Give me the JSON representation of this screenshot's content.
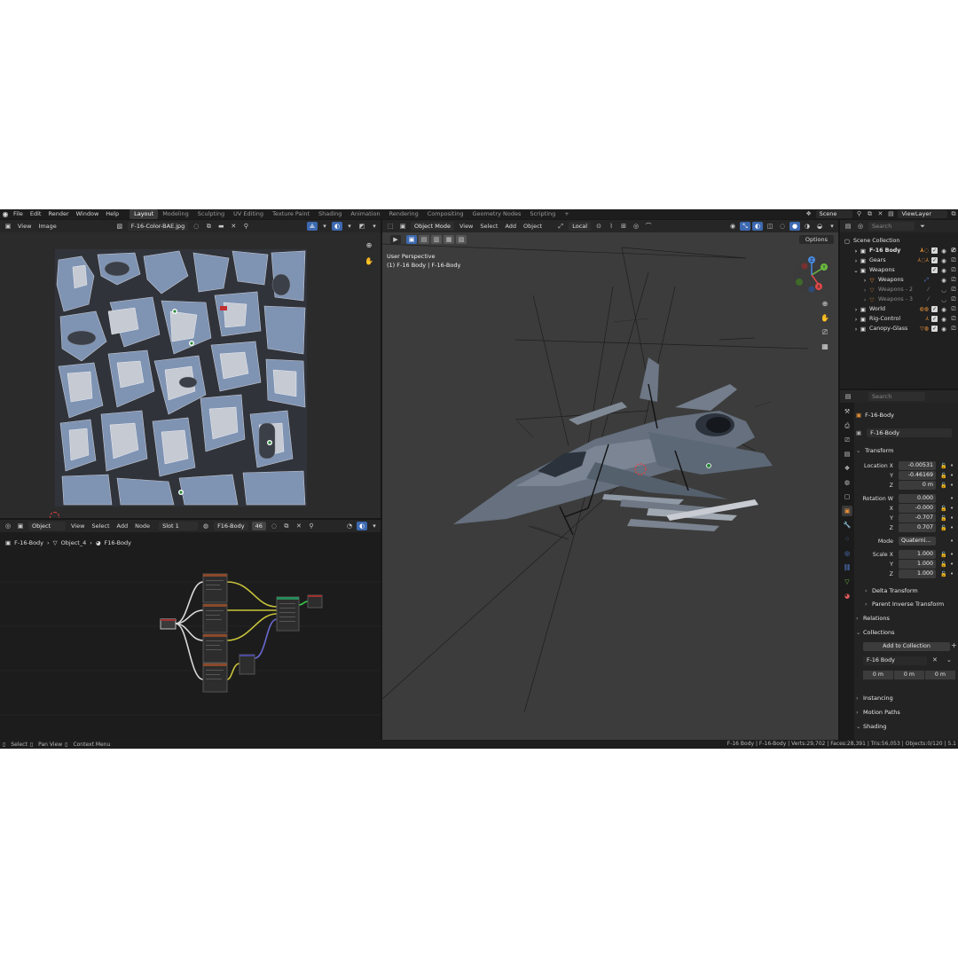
{
  "topbar": {
    "menu": [
      "File",
      "Edit",
      "Render",
      "Window",
      "Help"
    ],
    "workspaces": [
      "Layout",
      "Modeling",
      "Sculpting",
      "UV Editing",
      "Texture Paint",
      "Shading",
      "Animation",
      "Rendering",
      "Compositing",
      "Geometry Nodes",
      "Scripting"
    ],
    "active_workspace": "Layout",
    "add_tab": "+",
    "scene": "Scene",
    "view_layer": "ViewLayer"
  },
  "image_editor": {
    "view": "View",
    "image": "Image",
    "image_name": "F-16-Color-BAE.jpg"
  },
  "node_editor": {
    "object_mode": "Object",
    "view": "View",
    "select": "Select",
    "add": "Add",
    "node": "Node",
    "slot": "Slot 1",
    "material": "F16-Body",
    "user_count": "46",
    "breadcrumb": [
      "F-16-Body",
      "Object_4",
      "F16-Body"
    ]
  },
  "viewport": {
    "mode": "Object Mode",
    "view": "View",
    "select": "Select",
    "add": "Add",
    "object": "Object",
    "orientation": "Local",
    "options": "Options",
    "perspective": "User Perspective",
    "active_object": "(1) F-16 Body | F-16-Body",
    "gizmo_axes": [
      "Y",
      "X",
      "Z"
    ]
  },
  "outliner": {
    "search_placeholder": "Search",
    "items": [
      {
        "label": "Scene Collection",
        "dim": false
      },
      {
        "label": "F-16 Body",
        "dim": false
      },
      {
        "label": "Gears",
        "dim": false
      },
      {
        "label": "Weapons",
        "dim": false
      },
      {
        "label": "Weapons",
        "dim": false
      },
      {
        "label": "Weapons - 2",
        "dim": true
      },
      {
        "label": "Weapons - 3",
        "dim": true
      },
      {
        "label": "World",
        "dim": false
      },
      {
        "label": "Rig-Control",
        "dim": false
      },
      {
        "label": "Canopy-Glass",
        "dim": false
      }
    ]
  },
  "properties": {
    "search_placeholder": "Search",
    "object_name": "F-16-Body",
    "data_name": "F-16-Body",
    "transform_label": "Transform",
    "location": {
      "label": "Location X",
      "x": "-0.00531",
      "y": "-0.46169",
      "z": "0 m"
    },
    "rotation": {
      "label": "Rotation W",
      "w": "0.000",
      "x": "-0.000",
      "y": "-0.707",
      "z": "0.707"
    },
    "mode_label": "Mode",
    "mode_value": "Quaterni...",
    "scale": {
      "label": "Scale X",
      "x": "1.000",
      "y": "1.000",
      "z": "1.000"
    },
    "axis_y": "Y",
    "axis_z": "Z",
    "axis_x": "X",
    "delta_transform": "Delta Transform",
    "parent_inverse": "Parent Inverse Transform",
    "relations": "Relations",
    "collections": "Collections",
    "add_to_collection": "Add to Collection",
    "collection_name": "F-16 Body",
    "offsets": [
      "0 m",
      "0 m",
      "0 m"
    ],
    "instancing": "Instancing",
    "motion_paths": "Motion Paths",
    "shading": "Shading"
  },
  "statusbar": {
    "select": "Select",
    "pan_view": "Pan View",
    "context_menu": "Context Menu",
    "info": "F-16 Body | F-16-Body | Verts:29,702 | Faces:28,391 | Tris:56,053 | Objects:0/120 | 5.1"
  },
  "icons": [
    "blender-logo-icon",
    "editor-type-icon",
    "image-browse-icon",
    "pin-icon",
    "zoom-icon",
    "hand-icon",
    "camera-icon",
    "grid-icon",
    "funnel-icon",
    "eye-icon",
    "checkbox-icon",
    "lock-icon",
    "wrench-icon",
    "object-icon"
  ],
  "colors": {
    "accent_blue": "#3d69b0",
    "axis_x": "#e04848",
    "axis_y": "#6bbb40",
    "axis_z": "#4a8ae0",
    "orange_collection": "#e8913a"
  }
}
